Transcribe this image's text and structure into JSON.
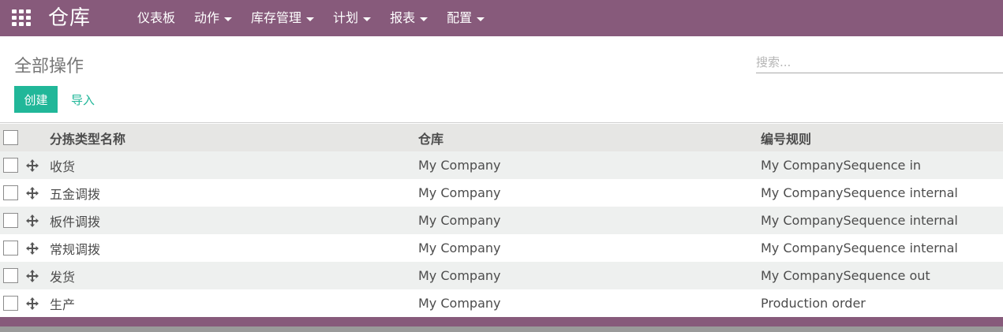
{
  "topbar": {
    "app_title": "仓库",
    "menu": [
      {
        "label": "仪表板",
        "dropdown": false
      },
      {
        "label": "动作",
        "dropdown": true
      },
      {
        "label": "库存管理",
        "dropdown": true
      },
      {
        "label": "计划",
        "dropdown": true
      },
      {
        "label": "报表",
        "dropdown": true
      },
      {
        "label": "配置",
        "dropdown": true
      }
    ],
    "color": "#875a7b"
  },
  "control_panel": {
    "breadcrumb": "全部操作",
    "search_placeholder": "搜索...",
    "create_label": "创建",
    "import_label": "导入"
  },
  "table": {
    "columns": [
      "分拣类型名称",
      "仓库",
      "编号规则"
    ],
    "rows": [
      [
        "收货",
        "My Company",
        "My CompanySequence in"
      ],
      [
        "五金调拨",
        "My Company",
        "My CompanySequence internal"
      ],
      [
        "板件调拨",
        "My Company",
        "My CompanySequence internal"
      ],
      [
        "常规调拨",
        "My Company",
        "My CompanySequence internal"
      ],
      [
        "发货",
        "My Company",
        "My CompanySequence out"
      ],
      [
        "生产",
        "My Company",
        "Production order"
      ]
    ]
  },
  "colors": {
    "accent": "#21b799",
    "brand": "#875a7b"
  },
  "icons": {
    "apps": "apps-grid-icon",
    "drag_handle": "drag-handle-icon"
  }
}
